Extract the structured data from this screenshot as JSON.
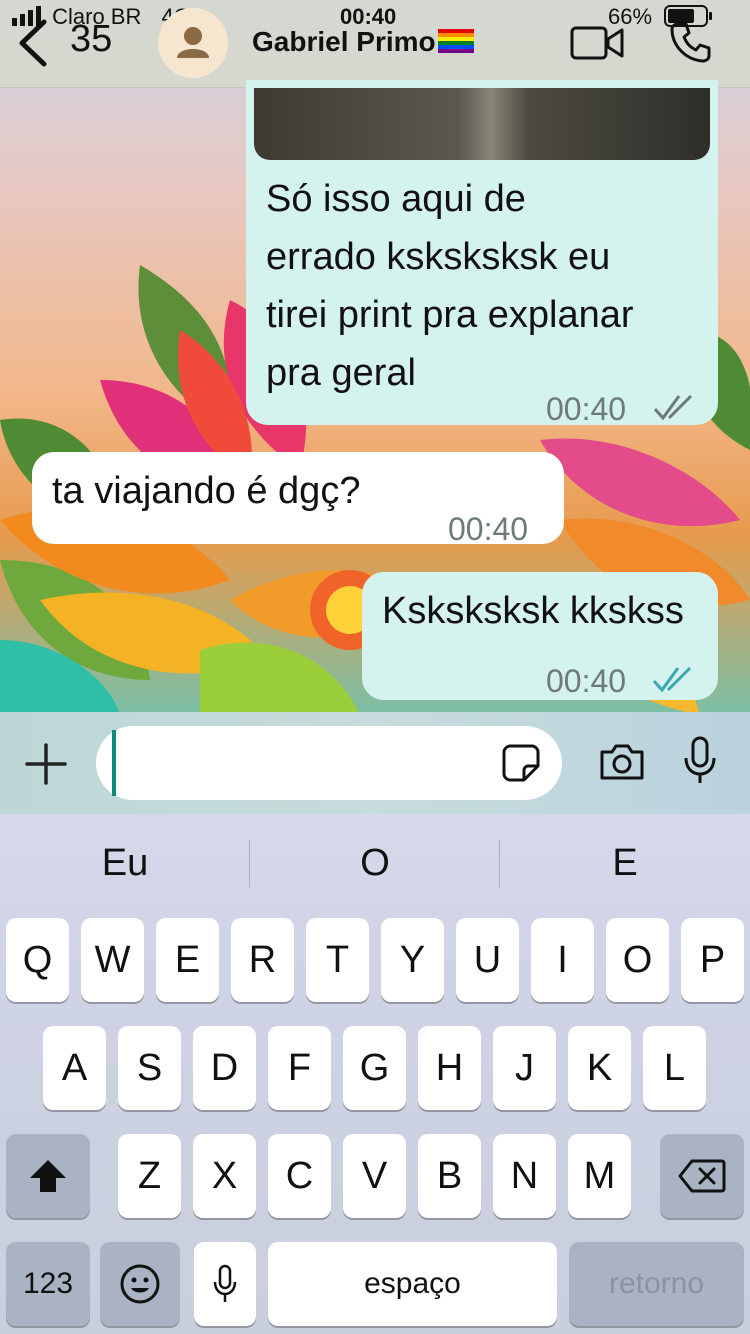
{
  "status_bar": {
    "carrier": "Claro BR",
    "network": "4G",
    "time": "00:40",
    "battery": "66%"
  },
  "header": {
    "back_count": "35",
    "contact_name": "Gabriel Primo",
    "flag": "🏳️‍🌈",
    "icons": [
      "back-chevron-icon",
      "avatar-icon",
      "video-call-icon",
      "phone-call-icon"
    ]
  },
  "messages": [
    {
      "direction": "outgoing",
      "lines": [
        "Só isso aqui de",
        "errado ksksksksk eu",
        "tirei print pra explanar",
        "pra geral"
      ],
      "time": "00:40",
      "status": "read"
    },
    {
      "direction": "incoming",
      "lines": [
        "ta viajando é dgç?"
      ],
      "time": "00:40"
    },
    {
      "direction": "outgoing",
      "lines": [
        "Ksksksksk kkskss"
      ],
      "time": "00:40",
      "status": "read"
    }
  ],
  "composer": {
    "value": "",
    "icons": [
      "plus-icon",
      "sticker-icon",
      "camera-icon",
      "microphone-icon"
    ]
  },
  "keyboard": {
    "suggestions": [
      "Eu",
      "O",
      "E"
    ],
    "row1": [
      "Q",
      "W",
      "E",
      "R",
      "T",
      "Y",
      "U",
      "I",
      "O",
      "P"
    ],
    "row2": [
      "A",
      "S",
      "D",
      "F",
      "G",
      "H",
      "J",
      "K",
      "L"
    ],
    "row3": [
      "Z",
      "X",
      "C",
      "V",
      "B",
      "N",
      "M"
    ],
    "numbers_key": "123",
    "space_key": "espaço",
    "return_key": "retorno"
  },
  "colors": {
    "outgoing_bubble": "#d4f2ee",
    "incoming_bubble": "#ffffff",
    "read_checks": "#3aa6b0"
  }
}
